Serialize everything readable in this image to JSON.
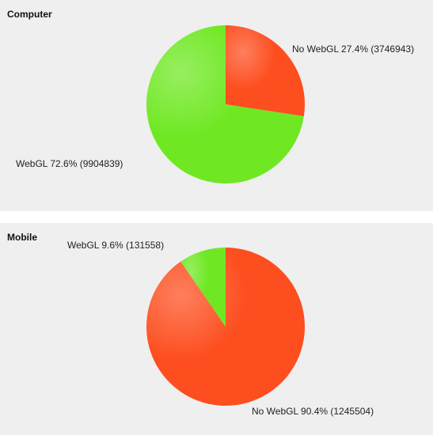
{
  "colors": {
    "webgl": "#6fe823",
    "no_webgl": "#fd4e1f"
  },
  "chart_data": [
    {
      "type": "pie",
      "title": "Computer",
      "start_angle_deg": 0,
      "slices": [
        {
          "name": "No WebGL",
          "percent": 27.4,
          "value": 3746943,
          "color": "#fd4e1f",
          "label": "No WebGL 27.4% (3746943)"
        },
        {
          "name": "WebGL",
          "percent": 72.6,
          "value": 9904839,
          "color": "#6fe823",
          "label": "WebGL 72.6% (9904839)"
        }
      ]
    },
    {
      "type": "pie",
      "title": "Mobile",
      "start_angle_deg": 0,
      "slices": [
        {
          "name": "No WebGL",
          "percent": 90.4,
          "value": 1245504,
          "color": "#fd4e1f",
          "label": "No WebGL 90.4% (1245504)"
        },
        {
          "name": "WebGL",
          "percent": 9.6,
          "value": 131558,
          "color": "#6fe823",
          "label": "WebGL 9.6% (131558)"
        }
      ]
    }
  ]
}
